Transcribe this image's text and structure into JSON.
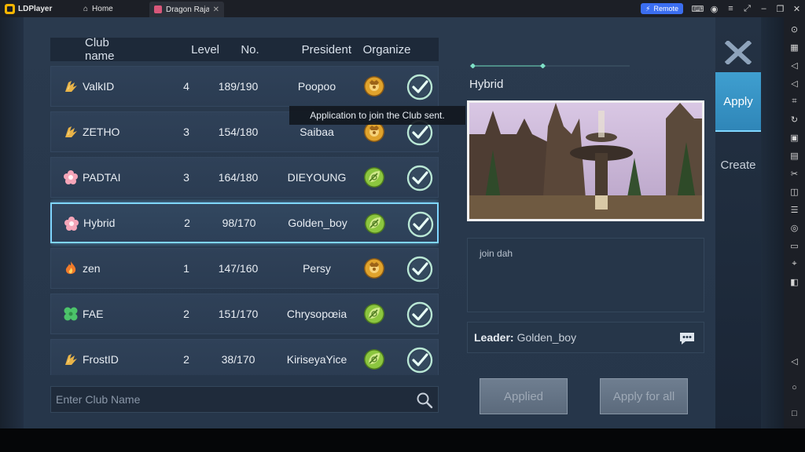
{
  "titlebar": {
    "brand": "LDPlayer",
    "home_tab": "Home",
    "game_tab": "Dragon Raja L...",
    "remote_label": "Remote"
  },
  "table": {
    "headers": {
      "name": "Club name",
      "level": "Level",
      "no": "No.",
      "president": "President",
      "organize": "Organize"
    },
    "rows": [
      {
        "name": "ValkID",
        "level": "4",
        "no": "189/190",
        "president": "Poopoo",
        "organize": "lion",
        "emblem": "wings",
        "selected": false
      },
      {
        "name": "ZETHO",
        "level": "3",
        "no": "154/180",
        "president": "Saibaa",
        "organize": "lion",
        "emblem": "wings",
        "selected": false
      },
      {
        "name": "PADTAI",
        "level": "3",
        "no": "164/180",
        "president": "DIEYOUNG",
        "organize": "leaf",
        "emblem": "flower",
        "selected": false
      },
      {
        "name": "Hybrid",
        "level": "2",
        "no": "98/170",
        "president": "Golden_boy",
        "organize": "leaf",
        "emblem": "flower",
        "selected": true
      },
      {
        "name": "zen",
        "level": "1",
        "no": "147/160",
        "president": "Persy",
        "organize": "lion",
        "emblem": "flame",
        "selected": false
      },
      {
        "name": "FAE",
        "level": "2",
        "no": "151/170",
        "president": "Chrysopœia",
        "organize": "leaf",
        "emblem": "clover",
        "selected": false
      },
      {
        "name": "FrostID",
        "level": "2",
        "no": "38/170",
        "president": "KiriseyaYice",
        "organize": "leaf",
        "emblem": "wings",
        "selected": false
      }
    ]
  },
  "tooltip": "Application to join the Club sent.",
  "search": {
    "placeholder": "Enter Club Name"
  },
  "detail": {
    "club_name": "Hybrid",
    "description": "join dah",
    "leader_label": "Leader:",
    "leader_name": "Golden_boy"
  },
  "buttons": {
    "applied": "Applied",
    "apply_all": "Apply for all"
  },
  "tabs": {
    "apply": "Apply",
    "create": "Create"
  },
  "colors": {
    "accent": "#7fd6ff",
    "apply_tab": "#3f9fd0",
    "lion_org": "#e0a32c",
    "leaf_org": "#8cc63f"
  }
}
